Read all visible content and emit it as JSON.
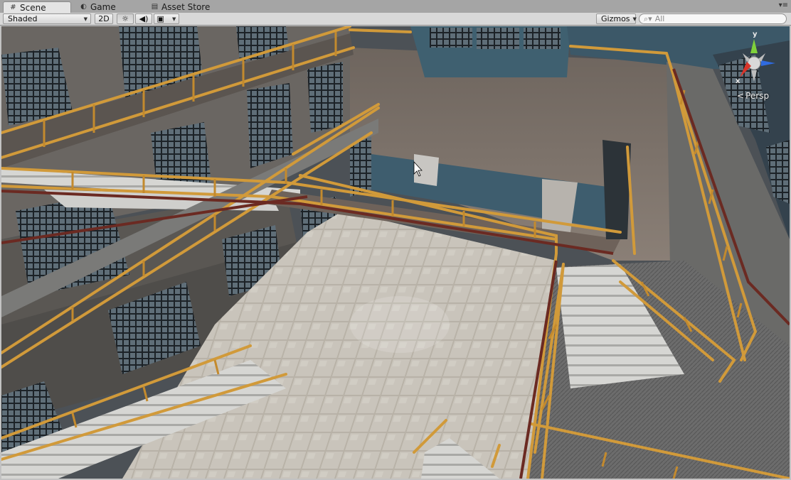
{
  "tabs": [
    {
      "label": "Scene",
      "icon": "hash-icon"
    },
    {
      "label": "Game",
      "icon": "pacman-icon"
    },
    {
      "label": "Asset Store",
      "icon": "store-icon"
    }
  ],
  "toolbar": {
    "shading_mode": "Shaded",
    "toggle_2d": "2D",
    "gizmos_label": "Gizmos",
    "search_placeholder": "All"
  },
  "scene_view": {
    "projection_label": "Persp",
    "axis_labels": {
      "y": "y",
      "x": "x"
    }
  },
  "colors": {
    "railing": "#d19a3a",
    "floor_tile": "#b9b4aa",
    "wall_blue": "#3d5a6c",
    "ceiling": "#6f655d"
  }
}
